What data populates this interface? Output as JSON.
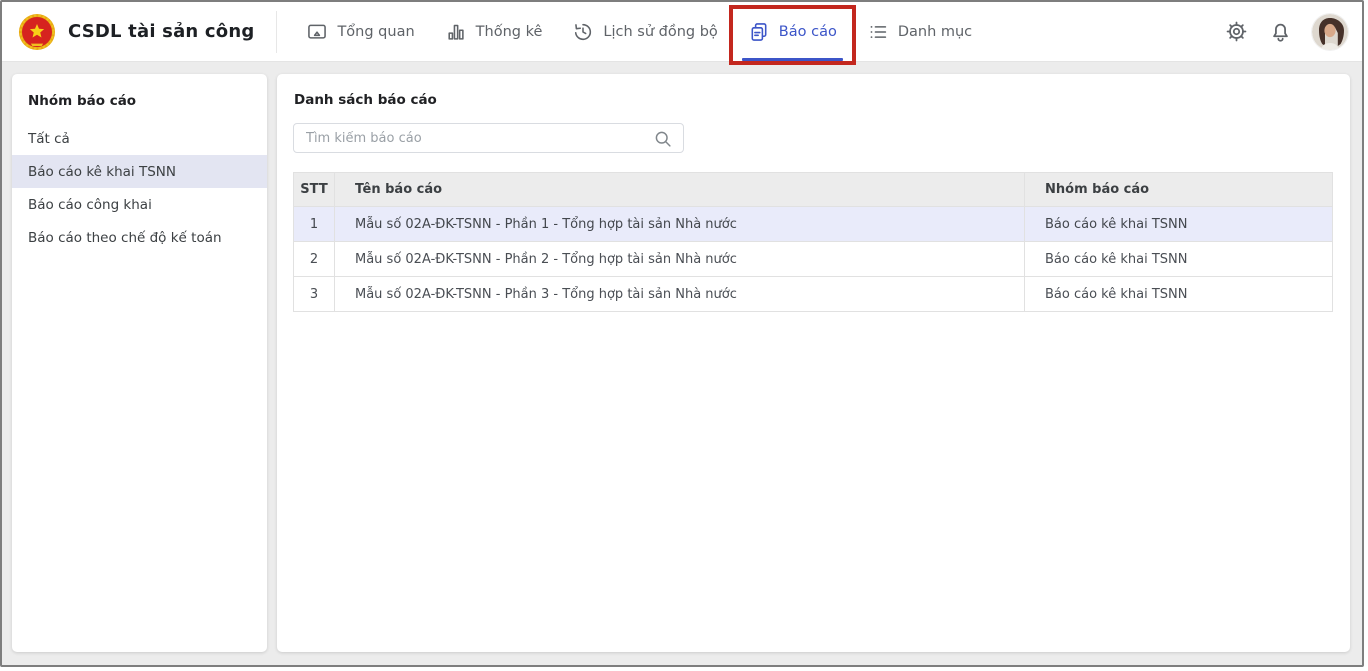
{
  "app": {
    "title": "CSDL tài sản công"
  },
  "nav": {
    "tabs": [
      {
        "label": "Tổng quan",
        "icon": "overview-icon",
        "active": false
      },
      {
        "label": "Thống kê",
        "icon": "statistics-icon",
        "active": false
      },
      {
        "label": "Lịch sử đồng bộ",
        "icon": "sync-history-icon",
        "active": false
      },
      {
        "label": "Báo cáo",
        "icon": "reports-icon",
        "active": true,
        "annotation": "red-highlight-box"
      },
      {
        "label": "Danh mục",
        "icon": "catalog-icon",
        "active": false
      }
    ]
  },
  "actions": {
    "settings_icon": "gear-icon",
    "notifications_icon": "bell-icon",
    "avatar": "user-avatar"
  },
  "sidebar": {
    "title": "Nhóm báo cáo",
    "items": [
      {
        "label": "Tất cả",
        "selected": false
      },
      {
        "label": "Báo cáo kê khai TSNN",
        "selected": true
      },
      {
        "label": "Báo cáo công khai",
        "selected": false
      },
      {
        "label": "Báo cáo theo chế độ kế toán",
        "selected": false
      }
    ]
  },
  "main": {
    "title": "Danh sách báo cáo",
    "search": {
      "placeholder": "Tìm kiếm báo cáo",
      "value": "",
      "icon": "search-icon"
    },
    "table": {
      "columns": [
        "STT",
        "Tên báo cáo",
        "Nhóm báo cáo"
      ],
      "rows": [
        {
          "stt": "1",
          "name": "Mẫu số 02A-ĐK-TSNN - Phần 1 - Tổng hợp tài sản Nhà nước",
          "group": "Báo cáo kê khai TSNN",
          "highlighted": true
        },
        {
          "stt": "2",
          "name": "Mẫu số 02A-ĐK-TSNN - Phần 2 - Tổng hợp tài sản Nhà nước",
          "group": "Báo cáo kê khai TSNN",
          "highlighted": false
        },
        {
          "stt": "3",
          "name": "Mẫu số 02A-ĐK-TSNN - Phần 3 - Tổng hợp tài sản Nhà nước",
          "group": "Báo cáo kê khai TSNN",
          "highlighted": false
        }
      ]
    }
  },
  "colors": {
    "accent_blue": "#3c55c8",
    "annotation_red": "#c3271e",
    "sidebar_selected_bg": "#e3e5f2",
    "row_highlight_bg": "#e9ebfa",
    "table_header_bg": "#ececec",
    "page_bg": "#ececec"
  }
}
